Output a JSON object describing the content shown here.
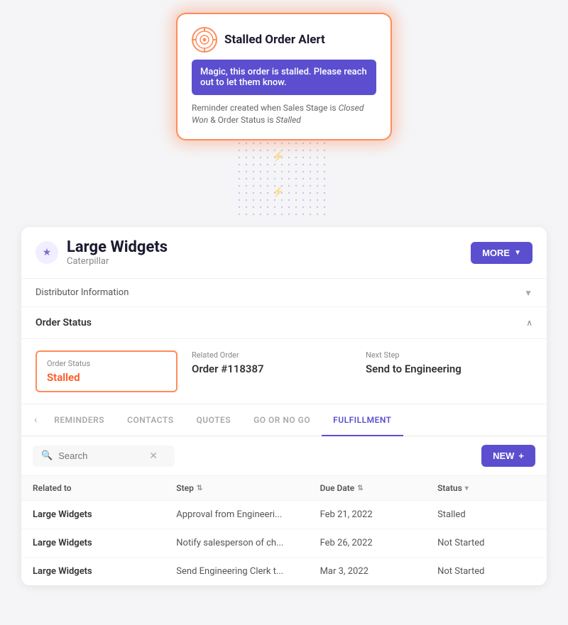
{
  "alert": {
    "title": "Stalled Order Alert",
    "message": "Magic, this order is stalled. Please reach out to let them know.",
    "reminder": "Reminder created when Sales Stage is",
    "reminder_italic1": "Closed Won",
    "reminder_between": " & Order Status is ",
    "reminder_italic2": "Stalled"
  },
  "card": {
    "title": "Large Widgets",
    "subtitle": "Caterpillar",
    "more_label": "MORE"
  },
  "distributor": {
    "label": "Distributor Information"
  },
  "order_status": {
    "section_title": "Order Status",
    "fields": [
      {
        "label": "Order Status",
        "value": "Stalled",
        "highlighted": true
      },
      {
        "label": "Related Order",
        "value": "Order #118387",
        "highlighted": false
      },
      {
        "label": "Next Step",
        "value": "Send to Engineering",
        "highlighted": false
      }
    ]
  },
  "tabs": {
    "items": [
      {
        "label": "REMINDERS",
        "active": false
      },
      {
        "label": "CONTACTS",
        "active": false
      },
      {
        "label": "QUOTES",
        "active": false
      },
      {
        "label": "GO OR NO GO",
        "active": false
      },
      {
        "label": "FULFILLMENT",
        "active": true
      }
    ]
  },
  "search": {
    "placeholder": "Search"
  },
  "new_button": "NEW",
  "table": {
    "headers": [
      {
        "label": "Related to",
        "sortable": false
      },
      {
        "label": "Step",
        "sortable": true
      },
      {
        "label": "Due Date",
        "sortable": true
      },
      {
        "label": "Status",
        "sortable": true
      }
    ],
    "rows": [
      {
        "related": "Large Widgets",
        "step": "Approval from Engineeri...",
        "due_date": "Feb 21, 2022",
        "status": "Stalled"
      },
      {
        "related": "Large Widgets",
        "step": "Notify salesperson of ch...",
        "due_date": "Feb 26, 2022",
        "status": "Not Started"
      },
      {
        "related": "Large Widgets",
        "step": "Send Engineering Clerk t...",
        "due_date": "Mar 3, 2022",
        "status": "Not Started"
      }
    ]
  },
  "colors": {
    "accent": "#5b4fcf",
    "alert_border": "#ff8c5a",
    "stalled": "#ff5722"
  }
}
